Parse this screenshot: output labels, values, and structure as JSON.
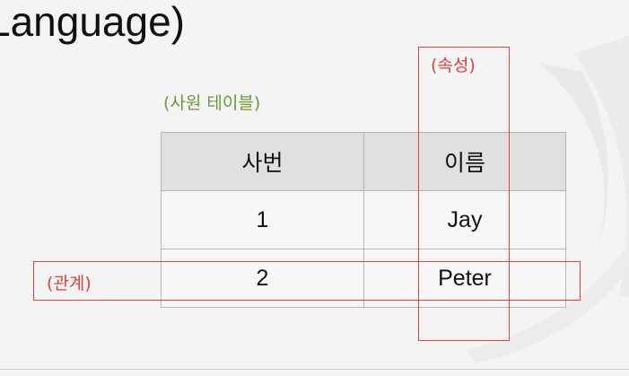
{
  "slide": {
    "title": "Language)",
    "table_caption": "(사원 테이블)",
    "attribute_label": "(속성)",
    "relation_label": "(관계)",
    "accent_color": "#e0403a",
    "caption_color": "#6a9a3a"
  },
  "table": {
    "headers": [
      "사번",
      "이름"
    ],
    "rows": [
      [
        "1",
        "Jay"
      ],
      [
        "2",
        "Peter"
      ]
    ]
  }
}
